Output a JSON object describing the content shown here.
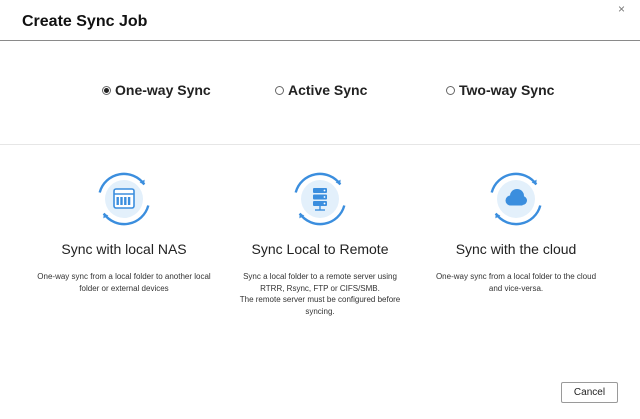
{
  "dialog": {
    "title": "Create Sync Job",
    "close_glyph": "×"
  },
  "modes": [
    {
      "label": "One-way Sync",
      "selected": true
    },
    {
      "label": "Active Sync",
      "selected": false
    },
    {
      "label": "Two-way Sync",
      "selected": false
    }
  ],
  "options": [
    {
      "title": "Sync with local NAS",
      "icon": "nas-sync-icon",
      "description": [
        "One-way sync from a local folder to another local",
        "folder or external devices"
      ]
    },
    {
      "title": "Sync Local to Remote",
      "icon": "server-sync-icon",
      "description": [
        "Sync a local folder to a remote server using",
        "RTRR, Rsync, FTP or CIFS/SMB.",
        "The remote server must be configured before",
        "syncing."
      ]
    },
    {
      "title": "Sync with the cloud",
      "icon": "cloud-sync-icon",
      "description": [
        "One-way sync from a local folder to the cloud",
        "and vice-versa."
      ]
    }
  ],
  "footer": {
    "cancel_label": "Cancel"
  },
  "colors": {
    "accent": "#3b8ede",
    "accent_light": "#e3f0fb",
    "divider": "#8a8a8a"
  }
}
